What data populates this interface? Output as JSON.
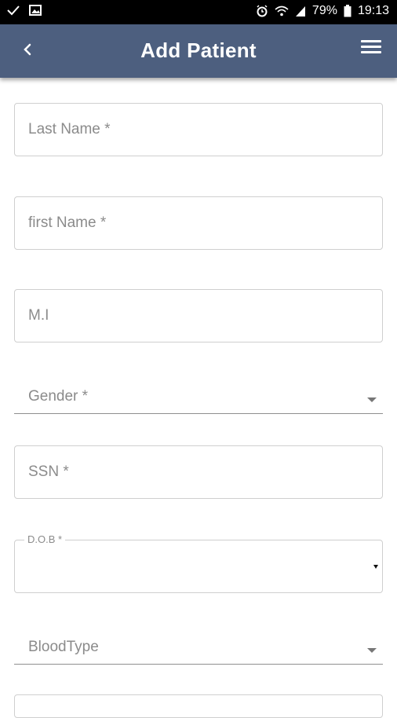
{
  "status_bar": {
    "battery": "79%",
    "time": "19:13"
  },
  "header": {
    "title": "Add Patient"
  },
  "form": {
    "last_name": {
      "placeholder": "Last Name *"
    },
    "first_name": {
      "placeholder": "first Name *"
    },
    "middle_initial": {
      "placeholder": "M.I"
    },
    "gender": {
      "label": "Gender *"
    },
    "ssn": {
      "placeholder": "SSN *"
    },
    "dob": {
      "label": "D.O.B *",
      "value": ""
    },
    "blood_type": {
      "label": "BloodType"
    }
  },
  "icons": {
    "back": "chevron-left-icon",
    "menu": "hamburger-menu-icon",
    "dropdown": "caret-down-icon"
  }
}
